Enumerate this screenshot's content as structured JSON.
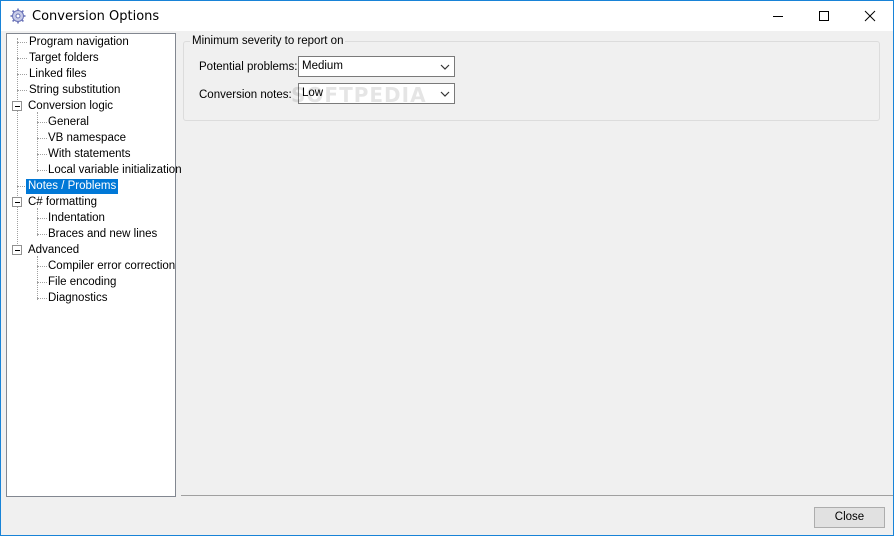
{
  "window": {
    "title": "Conversion Options"
  },
  "tree": {
    "items": [
      {
        "label": "Program navigation"
      },
      {
        "label": "Target folders"
      },
      {
        "label": "Linked files"
      },
      {
        "label": "String substitution"
      },
      {
        "label": "Conversion logic"
      },
      {
        "label": "General"
      },
      {
        "label": "VB namespace"
      },
      {
        "label": "With statements"
      },
      {
        "label": "Local variable initialization"
      },
      {
        "label": "Notes / Problems",
        "selected": true
      },
      {
        "label": "C# formatting"
      },
      {
        "label": "Indentation"
      },
      {
        "label": "Braces and new lines"
      },
      {
        "label": "Advanced"
      },
      {
        "label": "Compiler error correction"
      },
      {
        "label": "File encoding"
      },
      {
        "label": "Diagnostics"
      }
    ]
  },
  "group": {
    "caption": "Minimum severity to report on",
    "potential_label": "Potential problems:",
    "potential_value": "Medium",
    "notes_label": "Conversion notes:",
    "notes_value": "Low"
  },
  "watermark": "SOFTPEDIA",
  "footer": {
    "close_label": "Close"
  },
  "colors": {
    "selection": "#0078d7",
    "window_border": "#1883d7",
    "background": "#f0f0f0"
  }
}
